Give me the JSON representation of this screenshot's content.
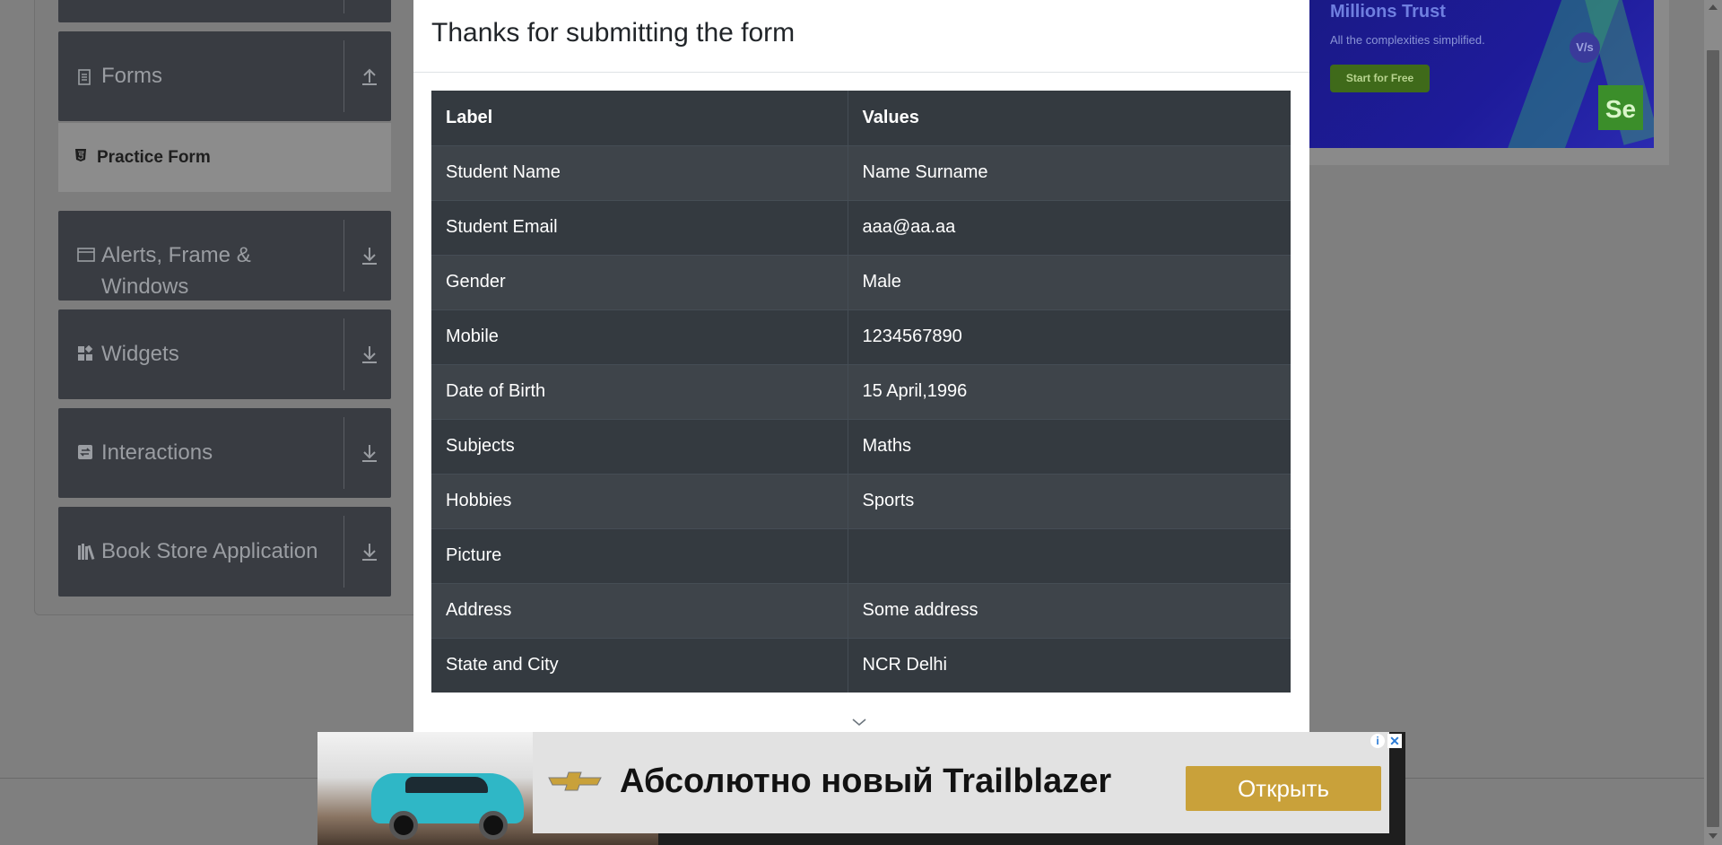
{
  "sidebar": {
    "groups": [
      {
        "title": "Forms",
        "icon": "document-icon",
        "expanded": true
      },
      {
        "title": "Alerts, Frame &",
        "title_line2": "Windows",
        "icon": "window-icon"
      },
      {
        "title": "Widgets",
        "icon": "widgets-icon"
      },
      {
        "title": "Interactions",
        "icon": "interactions-icon"
      },
      {
        "title": "Book Store Application",
        "icon": "books-icon"
      }
    ],
    "active_item": {
      "label": "Practice Form",
      "icon": "html5-icon"
    }
  },
  "top_ad": {
    "title": "Millions Trust",
    "subtitle": "All the complexities simplified.",
    "cta": "Start for Free",
    "badge": "V/s",
    "logo": "Se"
  },
  "modal": {
    "title": "Thanks for submitting the form",
    "table": {
      "headers": [
        "Label",
        "Values"
      ],
      "rows": [
        [
          "Student Name",
          "Name Surname"
        ],
        [
          "Student Email",
          "aaa@aa.aa"
        ],
        [
          "Gender",
          "Male"
        ],
        [
          "Mobile",
          "1234567890"
        ],
        [
          "Date of Birth",
          "15 April,1996"
        ],
        [
          "Subjects",
          "Maths"
        ],
        [
          "Hobbies",
          "Sports"
        ],
        [
          "Picture",
          ""
        ],
        [
          "Address",
          "Some address"
        ],
        [
          "State and City",
          "NCR Delhi"
        ]
      ]
    }
  },
  "bottom_ad": {
    "headline": "Абсолютно новый Trailblazer",
    "cta": "Открыть",
    "info": "i",
    "close": "✕"
  },
  "colors": {
    "table_dark": "#343a40",
    "table_stripe": "#3e444a",
    "ad_cta": "#c9a13a",
    "overlay": "#7f7f7f"
  }
}
